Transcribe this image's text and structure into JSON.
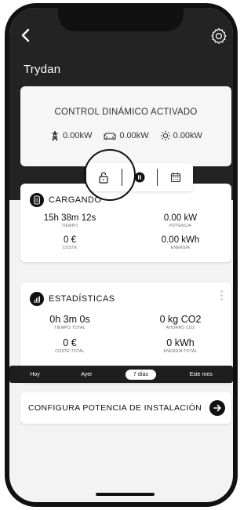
{
  "header": {
    "title": "Trydan"
  },
  "control": {
    "title": "CONTROL DINÁMICO ACTIVADO",
    "grid_power": "0.00kW",
    "car_power": "0.00kW",
    "solar_power": "0.00kW"
  },
  "toolbar": {
    "icons": [
      "unlock-icon",
      "pause-icon",
      "calendar-icon"
    ]
  },
  "charging": {
    "title": "CARGANDO",
    "time_value": "15h 38m 12s",
    "time_label": "TIEMPO",
    "power_value": "0.00 kW",
    "power_label": "POTENCIA",
    "cost_value": "0 €",
    "cost_label": "COSTE",
    "energy_value": "0.00 kWh",
    "energy_label": "ENERGÍA"
  },
  "stats": {
    "title": "ESTADÍSTICAS",
    "total_time_value": "0h 3m 0s",
    "total_time_label": "TIEMPO TOTAL",
    "co2_value": "0 kg CO2",
    "co2_label": "AHORRO CO2",
    "total_cost_value": "0 €",
    "total_cost_label": "COSTE TOTAL",
    "total_energy_value": "0 kWh",
    "total_energy_label": "ENERGÍA TOTAL",
    "periods": [
      "Hoy",
      "Ayer",
      "7 días",
      "Este mes"
    ],
    "active_period": "7 días"
  },
  "config": {
    "label": "CONFIGURA POTENCIA DE INSTALACIÓN"
  },
  "colors": {
    "header_bg": "#232323",
    "accent": "#111111",
    "surface": "#ffffff"
  }
}
